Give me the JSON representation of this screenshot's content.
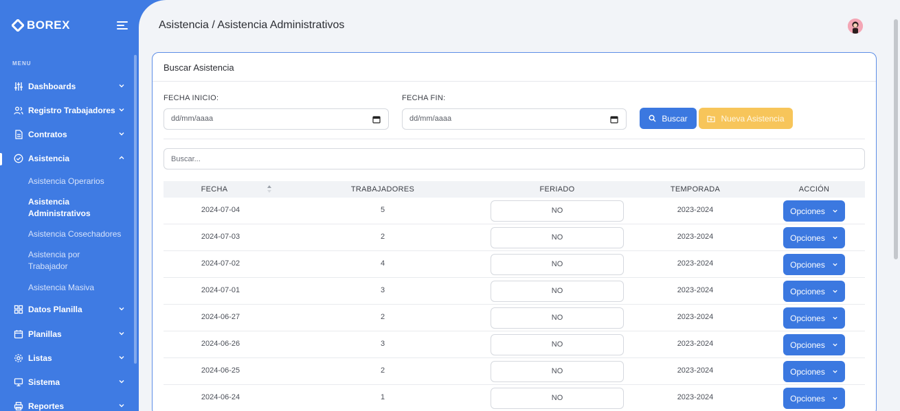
{
  "sidebar": {
    "brand": "BOREX",
    "menu_label": "MENU",
    "items": [
      {
        "label": "Dashboards",
        "icon": "sliders-icon",
        "chevron": "down"
      },
      {
        "label": "Registro Trabajadores",
        "icon": "users-icon",
        "chevron": "down"
      },
      {
        "label": "Contratos",
        "icon": "document-icon",
        "chevron": "down"
      },
      {
        "label": "Asistencia",
        "icon": "check-circle-icon",
        "chevron": "up"
      },
      {
        "label": "Datos Planilla",
        "icon": "grid-icon",
        "chevron": "down"
      },
      {
        "label": "Planillas",
        "icon": "calendar-icon",
        "chevron": "down"
      },
      {
        "label": "Listas",
        "icon": "gear-icon",
        "chevron": "down"
      },
      {
        "label": "Sistema",
        "icon": "monitor-icon",
        "chevron": "down"
      },
      {
        "label": "Reportes",
        "icon": "printer-icon",
        "chevron": "down"
      }
    ],
    "subitems": [
      {
        "label": "Asistencia Operarios"
      },
      {
        "label": "Asistencia Administrativos"
      },
      {
        "label": "Asistencia Cosechadores"
      },
      {
        "label": "Asistencia por Trabajador"
      },
      {
        "label": "Asistencia Masiva"
      }
    ]
  },
  "header": {
    "title": "Asistencia / Asistencia Administrativos"
  },
  "card": {
    "title": "Buscar Asistencia",
    "fecha_inicio_label": "FECHA INICIO:",
    "fecha_inicio_placeholder": "dd/mm/aaaa",
    "fecha_fin_label": "FECHA FIN:",
    "fecha_fin_placeholder": "dd/mm/aaaa",
    "buscar_label": "Buscar",
    "nueva_label": "Nueva Asistencia",
    "search_placeholder": "Buscar..."
  },
  "table": {
    "headers": [
      "FECHA",
      "TRABAJADORES",
      "FERIADO",
      "TEMPORADA",
      "ACCIÓN"
    ],
    "rows": [
      {
        "fecha": "2024-07-04",
        "trabajadores": "5",
        "feriado": "NO",
        "temporada": "2023-2024",
        "accion": "Opciones"
      },
      {
        "fecha": "2024-07-03",
        "trabajadores": "2",
        "feriado": "NO",
        "temporada": "2023-2024",
        "accion": "Opciones"
      },
      {
        "fecha": "2024-07-02",
        "trabajadores": "4",
        "feriado": "NO",
        "temporada": "2023-2024",
        "accion": "Opciones"
      },
      {
        "fecha": "2024-07-01",
        "trabajadores": "3",
        "feriado": "NO",
        "temporada": "2023-2024",
        "accion": "Opciones"
      },
      {
        "fecha": "2024-06-27",
        "trabajadores": "2",
        "feriado": "NO",
        "temporada": "2023-2024",
        "accion": "Opciones"
      },
      {
        "fecha": "2024-06-26",
        "trabajadores": "3",
        "feriado": "NO",
        "temporada": "2023-2024",
        "accion": "Opciones"
      },
      {
        "fecha": "2024-06-25",
        "trabajadores": "2",
        "feriado": "NO",
        "temporada": "2023-2024",
        "accion": "Opciones"
      },
      {
        "fecha": "2024-06-24",
        "trabajadores": "1",
        "feriado": "NO",
        "temporada": "2023-2024",
        "accion": "Opciones"
      }
    ]
  },
  "colors": {
    "sidebar": "#3f7be3",
    "primary_button": "#3b78e0",
    "warning_button": "#f7c55a",
    "background": "#f2f4f8"
  }
}
